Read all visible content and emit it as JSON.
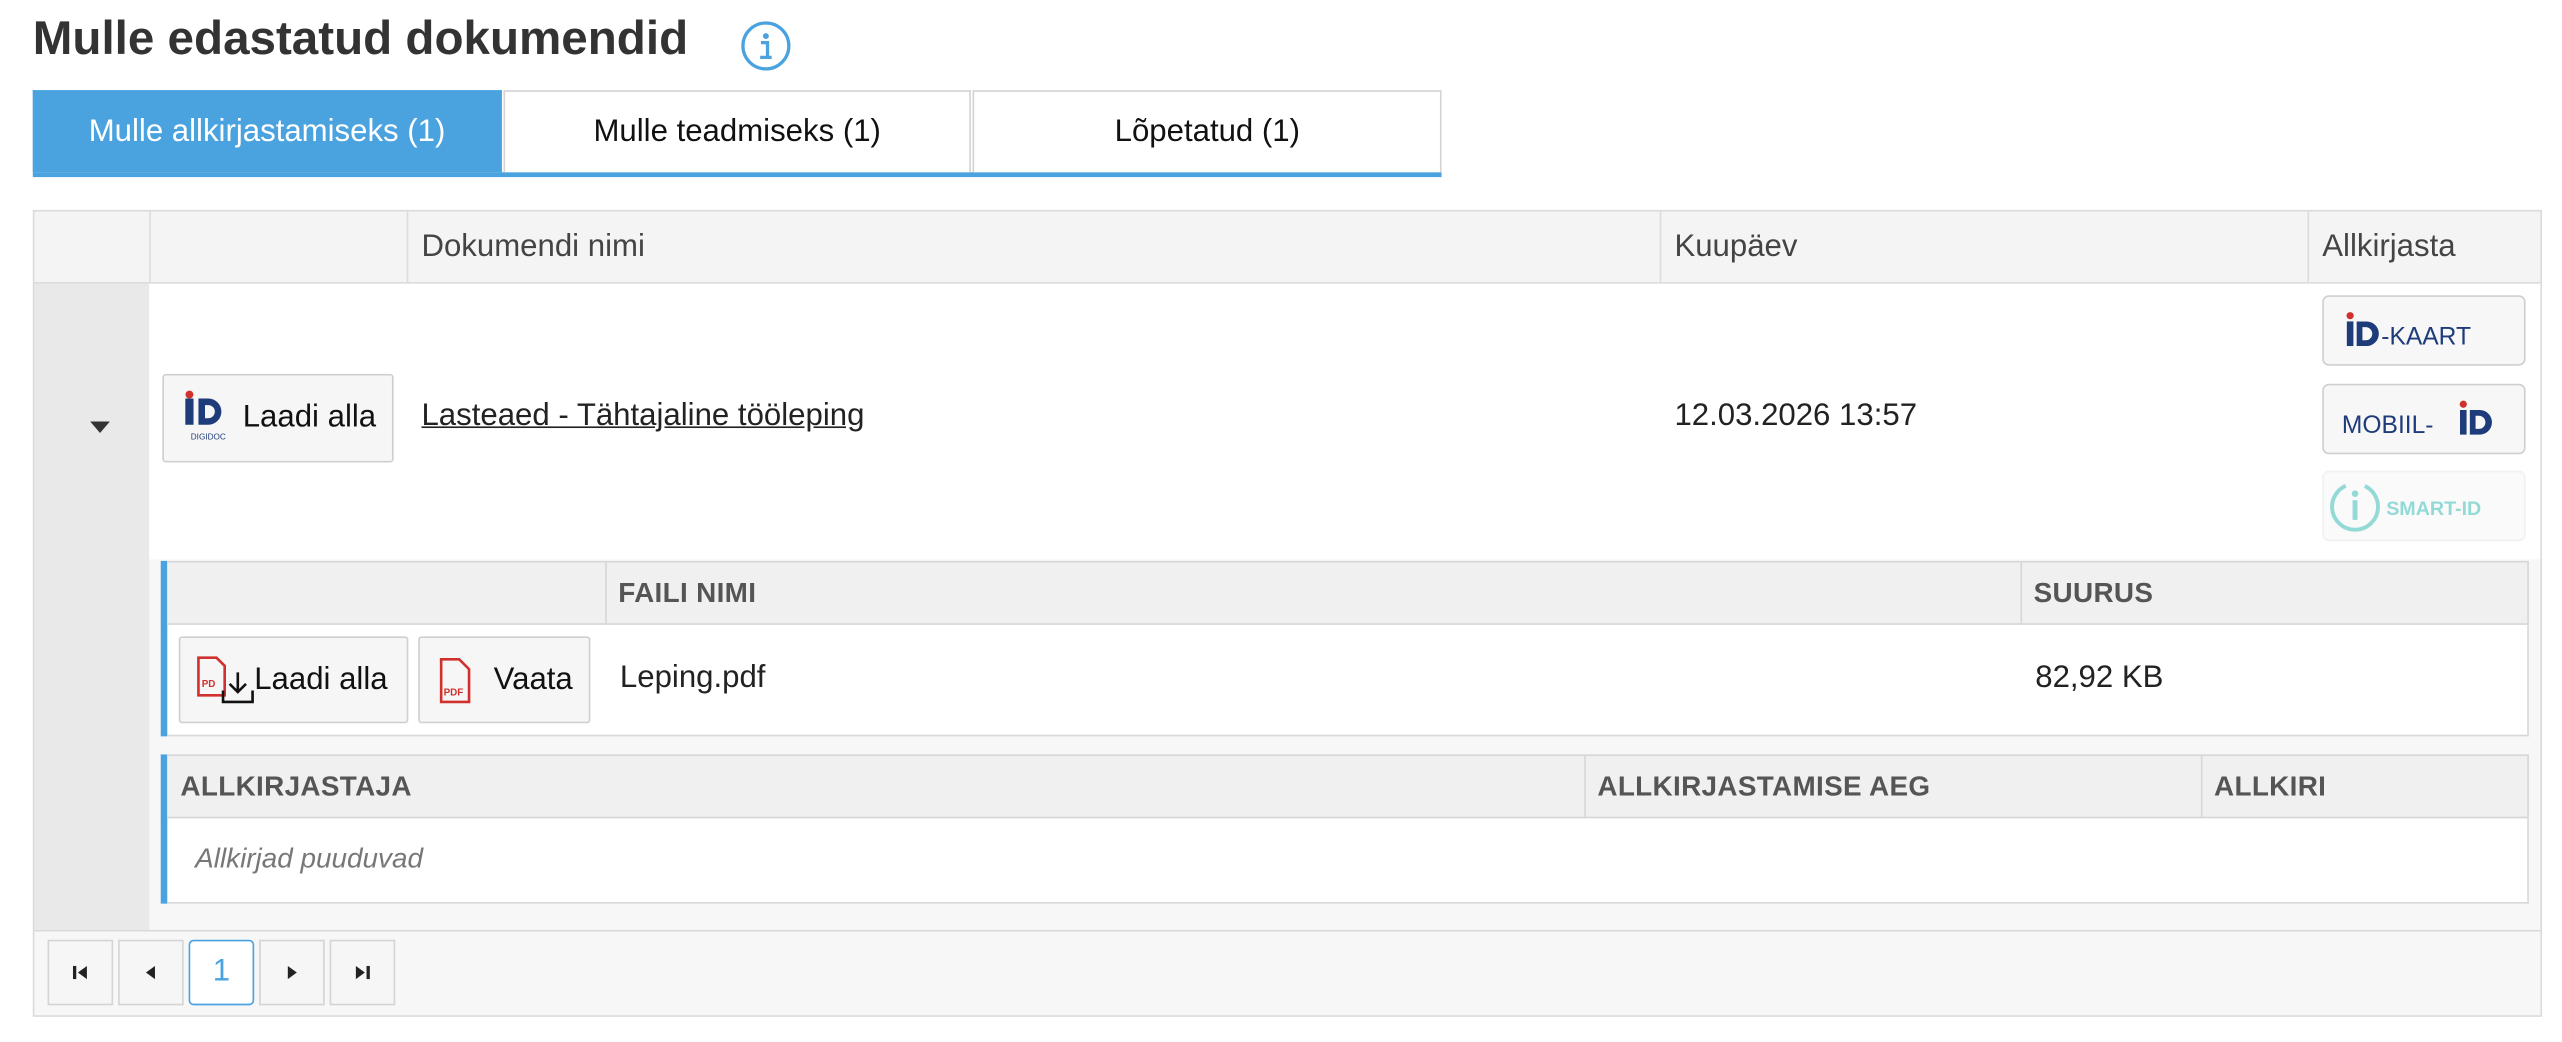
{
  "page": {
    "title": "Mulle edastatud dokumendid"
  },
  "tabs": [
    {
      "label": "Mulle allkirjastamiseks (1)",
      "active": true
    },
    {
      "label": "Mulle teadmiseks (1)",
      "active": false
    },
    {
      "label": "Lõpetatud (1)",
      "active": false
    }
  ],
  "grid": {
    "headers": {
      "document_name": "Dokumendi nimi",
      "date": "Kuupäev",
      "sign": "Allkirjasta"
    },
    "row": {
      "download_label": "Laadi alla",
      "digidoc_logo_text": "DIGIDOC",
      "document_name": "Lasteaed - Tähtajaline tööleping",
      "date": "12.03.2026 13:57",
      "sign_options": {
        "id_card": "-KAART",
        "mobile_id": "MOBIIL-",
        "smart_id": "SMART-ID"
      }
    }
  },
  "files": {
    "headers": {
      "file_name": "FAILI NIMI",
      "size": "SUURUS"
    },
    "rows": [
      {
        "download_label": "Laadi alla",
        "view_label": "Vaata",
        "file_name": "Leping.pdf",
        "size": "82,92 KB"
      }
    ]
  },
  "signatures": {
    "headers": {
      "signer": "ALLKIRJASTAJA",
      "signing_time": "ALLKIRJASTAMISE AEG",
      "signature": "ALLKIRI"
    },
    "empty_text": "Allkirjad puuduvad"
  },
  "pager": {
    "current_page": "1"
  },
  "colors": {
    "accent": "#4aa3df",
    "id_blue": "#1f3c7a",
    "smart_id": "#3bbcb8",
    "pdf_red": "#d0312d"
  }
}
